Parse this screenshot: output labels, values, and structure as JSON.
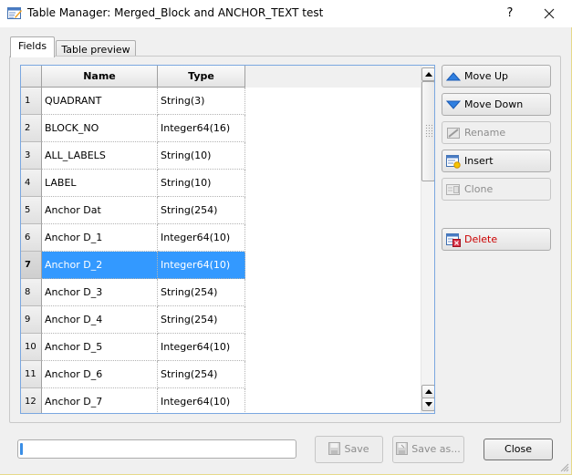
{
  "window": {
    "title": "Table Manager: Merged_Block and ANCHOR_TEXT test",
    "help_label": "?",
    "close_icon": "close-icon"
  },
  "tabs": [
    {
      "label": "Fields",
      "active": true
    },
    {
      "label": "Table preview",
      "active": false
    }
  ],
  "table": {
    "columns": [
      "Name",
      "Type"
    ],
    "selected_row": 7,
    "rows": [
      {
        "num": "1",
        "name": "QUADRANT",
        "type": "String(3)"
      },
      {
        "num": "2",
        "name": "BLOCK_NO",
        "type": "Integer64(16)"
      },
      {
        "num": "3",
        "name": "ALL_LABELS",
        "type": "String(10)"
      },
      {
        "num": "4",
        "name": "LABEL",
        "type": "String(10)"
      },
      {
        "num": "5",
        "name": "Anchor Dat",
        "type": "String(254)"
      },
      {
        "num": "6",
        "name": "Anchor D_1",
        "type": "Integer64(10)"
      },
      {
        "num": "7",
        "name": "Anchor D_2",
        "type": "Integer64(10)"
      },
      {
        "num": "8",
        "name": "Anchor D_3",
        "type": "String(254)"
      },
      {
        "num": "9",
        "name": "Anchor D_4",
        "type": "String(254)"
      },
      {
        "num": "10",
        "name": "Anchor D_5",
        "type": "Integer64(10)"
      },
      {
        "num": "11",
        "name": "Anchor D_6",
        "type": "String(254)"
      },
      {
        "num": "12",
        "name": "Anchor D_7",
        "type": "Integer64(10)"
      }
    ]
  },
  "side_buttons": {
    "move_up": {
      "label": "Move Up",
      "icon": "arrow-up-icon",
      "enabled": true
    },
    "move_down": {
      "label": "Move Down",
      "icon": "arrow-down-icon",
      "enabled": true
    },
    "rename": {
      "label": "Rename",
      "icon": "rename-icon",
      "enabled": false
    },
    "insert": {
      "label": "Insert",
      "icon": "insert-field-icon",
      "enabled": true
    },
    "clone": {
      "label": "Clone",
      "icon": "clone-icon",
      "enabled": false
    },
    "delete": {
      "label": "Delete",
      "icon": "delete-field-icon",
      "enabled": true
    }
  },
  "footer": {
    "progress_value": 0,
    "save_label": "Save",
    "save_as_label": "Save as...",
    "close_label": "Close"
  },
  "colors": {
    "selection": "#3399ff",
    "delete_text": "#cc0000",
    "frame_focus": "#7aa7e0"
  }
}
